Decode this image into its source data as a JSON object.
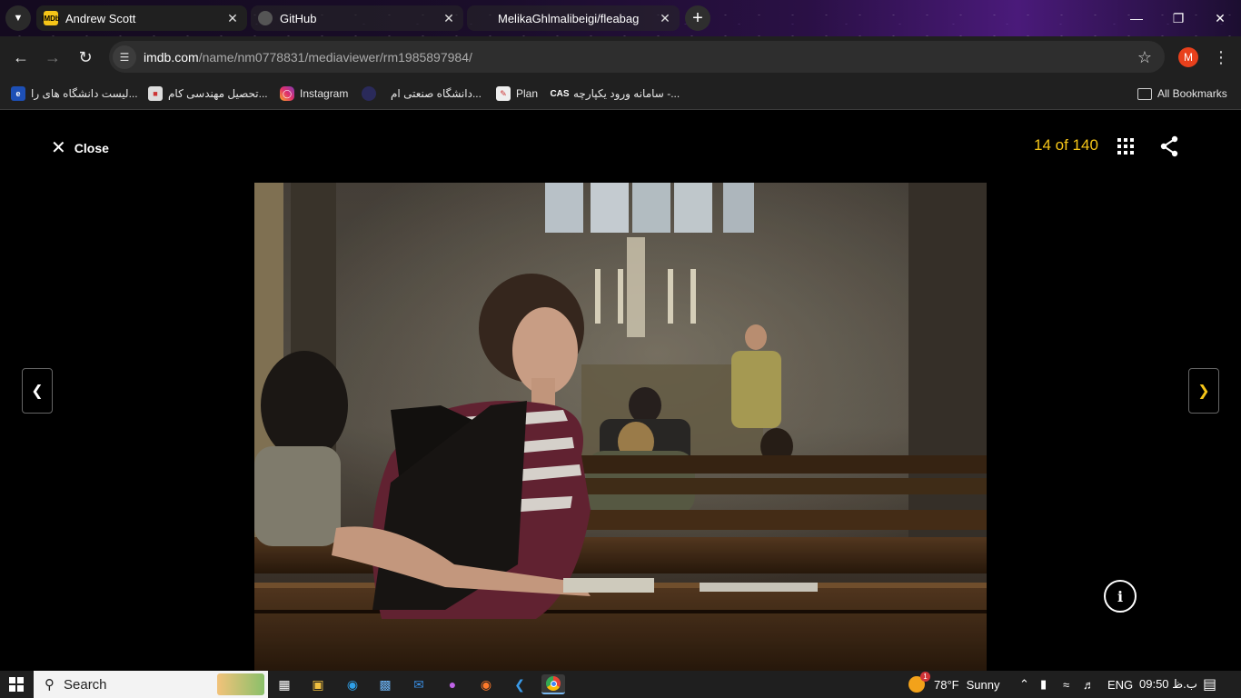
{
  "browser": {
    "tabs": [
      {
        "title": "Andrew Scott",
        "favicon": "imdb-icon",
        "active": true
      },
      {
        "title": "GitHub",
        "favicon": "github-icon",
        "active": false
      },
      {
        "title": "MelikaGhlmalibeigi/fleabag",
        "favicon": "",
        "active": false
      }
    ],
    "url_domain": "imdb.com",
    "url_path": "/name/nm0778831/mediaviewer/rm1985897984/",
    "profile_initial": "M",
    "bookmarks": [
      {
        "label": "لیست دانشگاه های را...",
        "icon": "uni-list-icon"
      },
      {
        "label": "تحصیل مهندسی کام...",
        "icon": "edu-icon"
      },
      {
        "label": "Instagram",
        "icon": "instagram-icon"
      },
      {
        "label": "دانشگاه صنعتی ام...",
        "icon": "university-icon"
      },
      {
        "label": "Plan",
        "icon": "plan-icon"
      },
      {
        "label": "سامانه ورود یکپارچه -...",
        "icon": "cas-icon"
      }
    ],
    "all_bookmarks": "All Bookmarks"
  },
  "viewer": {
    "close_label": "Close",
    "counter": "14 of 140",
    "accent": "#f5c518"
  },
  "taskbar": {
    "search_placeholder": "Search",
    "weather_temp": "78°F",
    "weather_cond": "Sunny",
    "weather_badge": "1",
    "lang": "ENG",
    "time": "09:50 ب.ظ"
  }
}
